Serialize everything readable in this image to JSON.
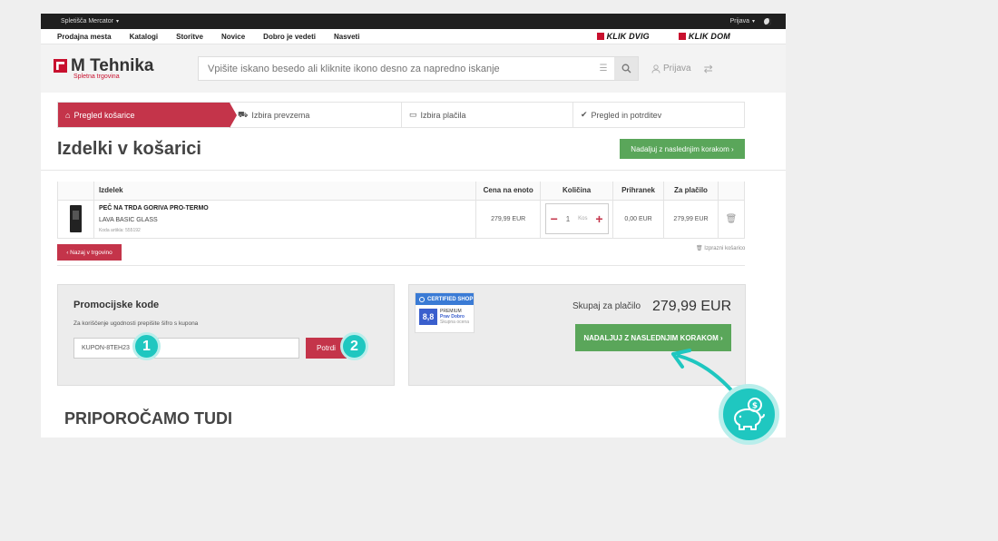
{
  "topbar": {
    "store": "Spletišča Mercator",
    "login": "Prijava"
  },
  "nav": {
    "items": [
      "Prodajna mesta",
      "Katalogi",
      "Storitve",
      "Novice",
      "Dobro je vedeti",
      "Nasveti"
    ],
    "brands": [
      "KLIK DVIG",
      "KLIK DOM"
    ]
  },
  "header": {
    "logo": "M Tehnika",
    "logo_sub": "Spletna trgovina",
    "search_placeholder": "Vpišite iskano besedo ali kliknite ikono desno za napredno iskanje",
    "login": "Prijava"
  },
  "steps": [
    "Pregled košarice",
    "Izbira prevzema",
    "Izbira plačila",
    "Pregled in potrditev"
  ],
  "page": {
    "title": "Izdelki v košarici",
    "next_top": "Nadaljuj z naslednjim korakom ›"
  },
  "cart": {
    "headers": [
      "Izdelek",
      "Cena na enoto",
      "Količina",
      "Prihranek",
      "Za plačilo"
    ],
    "item": {
      "name": "PEČ NA TRDA GORIVA PRO-TERMO",
      "variant": "LAVA BASIC GLASS",
      "code": "Koda artikla: 555192",
      "price": "279,99 EUR",
      "qty": "1",
      "unit": "Kos",
      "saving": "0,00 EUR",
      "total": "279,99 EUR"
    },
    "back": "‹ Nazaj v trgovino",
    "empty": "Izprazni košarico"
  },
  "promo": {
    "title": "Promocijske kode",
    "desc": "Za koriščenje ugodnosti prepišite šifro s kupona",
    "value": "KUPON-8TEH23",
    "confirm": "Potrdi",
    "badge1": "1",
    "badge2": "2"
  },
  "summary": {
    "cert_title": "CERTIFIED SHOP",
    "cert_score": "8,8",
    "cert_line1": "PREMIUM",
    "cert_line2": "Prav Dobro",
    "cert_line3": "Skupna ocena",
    "label": "Skupaj za plačilo",
    "value": "279,99 EUR",
    "next": "NADALJUJ Z NASLEDNJIM KORAKOM ›"
  },
  "recommend": "PRIPOROČAMO TUDI",
  "colors": {
    "primary_red": "#c4344a",
    "green": "#5aa65a",
    "accent_teal": "#1fc7c0"
  }
}
